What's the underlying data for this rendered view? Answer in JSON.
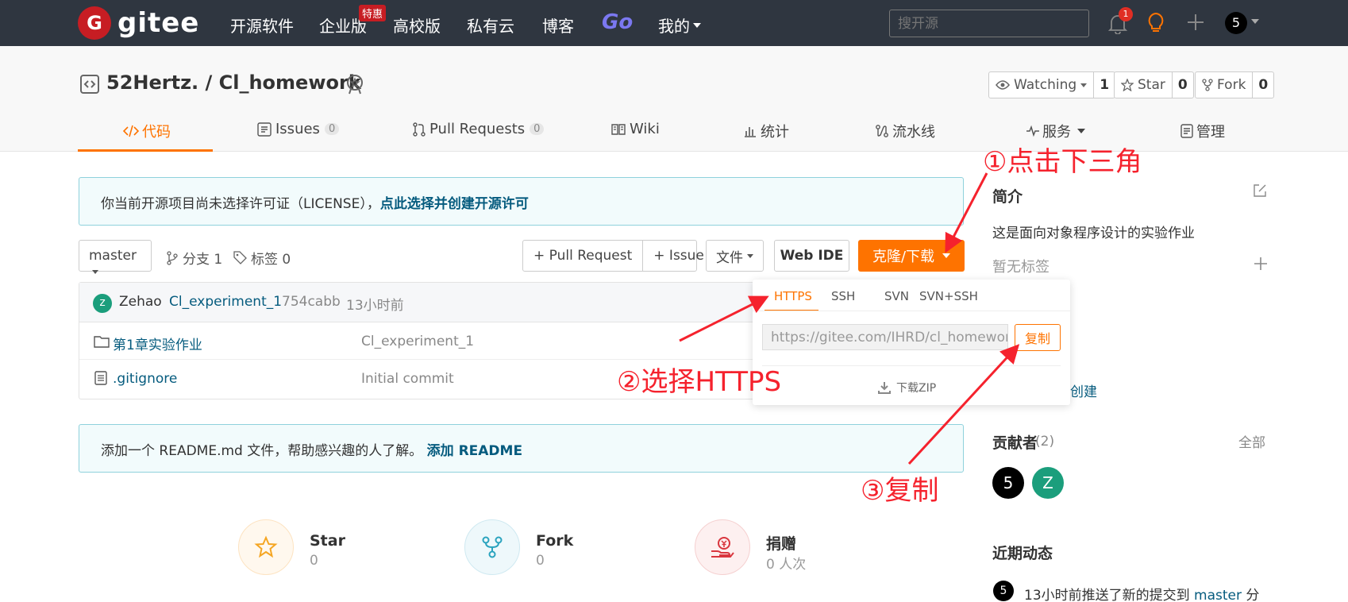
{
  "topnav": {
    "logo_text": "gitee",
    "items": [
      "开源软件",
      "企业版",
      "高校版",
      "私有云",
      "博客"
    ],
    "hot_badge": "特惠",
    "go": "Go",
    "mine": "我的",
    "search_placeholder": "搜开源",
    "notification_count": "1",
    "user_avatar": "5"
  },
  "repo": {
    "title": "52Hertz. / Cl_homework",
    "watching_label": "Watching",
    "watching_count": "1",
    "star_label": "Star",
    "star_count": "0",
    "fork_label": "Fork",
    "fork_count": "0"
  },
  "tabs": [
    {
      "label": "代码"
    },
    {
      "label": "Issues",
      "count": "0"
    },
    {
      "label": "Pull Requests",
      "count": "0"
    },
    {
      "label": "Wiki"
    },
    {
      "label": "统计"
    },
    {
      "label": "流水线"
    },
    {
      "label": "服务"
    },
    {
      "label": "管理"
    }
  ],
  "license": {
    "text": "你当前开源项目尚未选择许可证（LICENSE），",
    "link": "点此选择并创建开源许可"
  },
  "toolbar": {
    "branch": "master",
    "branches": "分支 1",
    "tags": "标签 0",
    "pull_request": "+ Pull Request",
    "issue": "+ Issue",
    "file": "文件",
    "web_ide": "Web IDE",
    "clone": "克隆/下载"
  },
  "commit": {
    "avatar": "z",
    "author": "Zehao",
    "message": "Cl_experiment_1",
    "hash": "754cabb",
    "time": "13小时前"
  },
  "files": [
    {
      "name": "第1章实验作业",
      "commit": "Cl_experiment_1",
      "type": "folder"
    },
    {
      "name": ".gitignore",
      "commit": "Initial commit",
      "type": "file"
    }
  ],
  "readme": {
    "text": "添加一个 README.md 文件，帮助感兴趣的人了解。",
    "link": "添加 README"
  },
  "stats": [
    {
      "label": "Star",
      "value": "0"
    },
    {
      "label": "Fork",
      "value": "0"
    },
    {
      "label": "捐赠",
      "value": "0 人次"
    }
  ],
  "clone_dropdown": {
    "tabs": [
      "HTTPS",
      "SSH",
      "SVN",
      "SVN+SSH"
    ],
    "url": "https://gitee.com/IHRD/cl_homework.git",
    "copy": "复制",
    "download_zip": "下载ZIP"
  },
  "sidebar": {
    "intro_title": "简介",
    "intro_text": "这是面向对象程序设计的实验作业",
    "no_tags": "暂无标签",
    "create": "创建",
    "contributors_title": "贡献者",
    "contributors_count": "(2)",
    "all": "全部",
    "contributors": [
      "5",
      "Z"
    ],
    "activity_title": "近期动态",
    "activity_avatar": "5",
    "activity_text": "13小时前推送了新的提交到",
    "activity_branch": "master",
    "activity_tail": "分"
  },
  "annotations": {
    "step1": "①点击下三角",
    "step2": "②选择HTTPS",
    "step3": "③复制"
  },
  "colors": {
    "topbar": "#2f3640",
    "accent": "#fe7300",
    "brand": "#c71d23",
    "annotation": "#f5222d",
    "link": "#055b7e"
  }
}
